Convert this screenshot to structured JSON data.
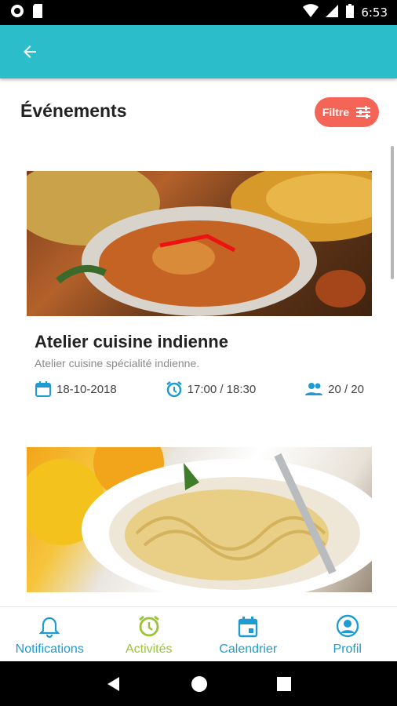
{
  "status_bar": {
    "time": "6:53"
  },
  "page": {
    "title": "Événements",
    "filter_label": "Filtre"
  },
  "events": [
    {
      "title": "Atelier cuisine indienne",
      "description": "Atelier cuisine spécialité indienne.",
      "date": "18-10-2018",
      "time": "17:00 / 18:30",
      "participants": "20 / 20"
    },
    {
      "title": "",
      "description": ""
    }
  ],
  "bottom_nav": [
    {
      "label": "Notifications",
      "icon": "bell-icon"
    },
    {
      "label": "Activités",
      "icon": "alarm-clock-icon"
    },
    {
      "label": "Calendrier",
      "icon": "calendar-icon"
    },
    {
      "label": "Profil",
      "icon": "profile-icon"
    }
  ],
  "colors": {
    "appbar": "#2cbdcb",
    "filter": "#f46457",
    "accent_blue": "#1e9bd0",
    "accent_green": "#9bc33a"
  }
}
